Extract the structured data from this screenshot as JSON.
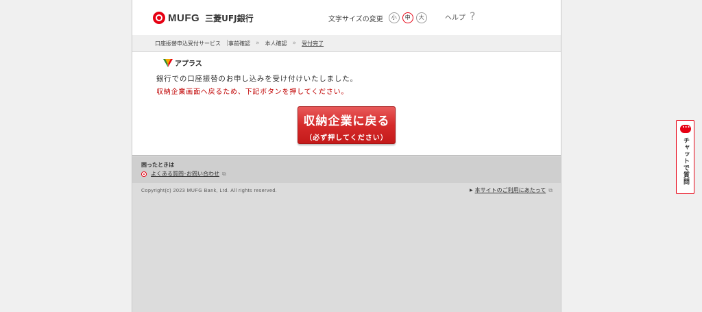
{
  "header": {
    "logo_text": "MUFG",
    "bank_name": "三菱UFJ銀行",
    "text_size_label": "文字サイズの変更",
    "text_size_options": [
      "小",
      "中",
      "大"
    ],
    "text_size_selected": "中",
    "help_label": "ヘルプ",
    "help_icon": "question-icon"
  },
  "breadcrumb": {
    "service": "口座振替申込受付サービス",
    "steps": [
      "事前確認",
      "本人確認",
      "受付完了"
    ],
    "current_step": "受付完了"
  },
  "content": {
    "brand_name": "アプラス",
    "message": "銀行での口座振替のお申し込みを受け付けいたしました。",
    "notice": "収納企業画面へ戻るため、下記ボタンを押してください。",
    "return_button": "収納企業に戻る",
    "return_button_sub": "（必ず押してください）"
  },
  "footer": {
    "trouble_title": "困ったときは",
    "faq_link": "よくある質問･お問い合わせ",
    "copyright": "Copyright(c) 2023 MUFG Bank, Ltd. All rights reserved.",
    "terms_link": "本サイトのご利用にあたって"
  },
  "chat": {
    "label": "チャットで質問"
  },
  "colors": {
    "brand_red": "#e60012",
    "notice_red": "#c00000",
    "button_red": "#d52a2a"
  }
}
